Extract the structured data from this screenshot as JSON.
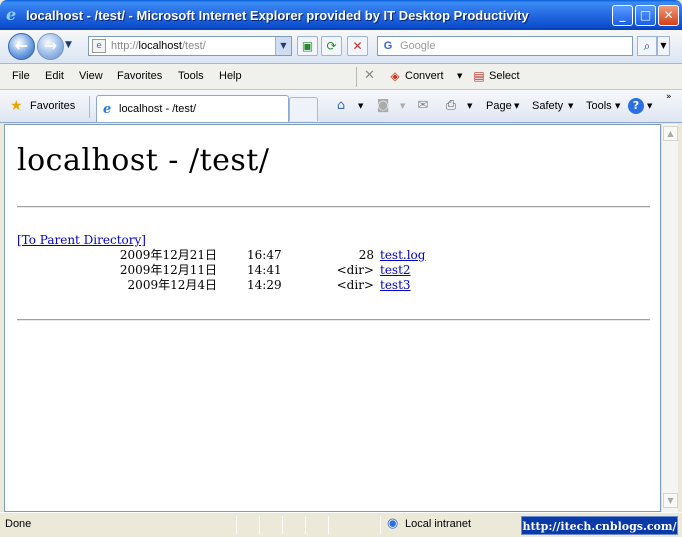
{
  "window": {
    "title": "localhost - /test/ - Microsoft Internet Explorer provided by IT Desktop Productivity",
    "controls": {
      "minimize": "_",
      "maximize": "□",
      "close": "✕"
    }
  },
  "address": {
    "url_prefix": "http://",
    "url_host": "localhost",
    "url_path": "/test/",
    "search_placeholder": "Google"
  },
  "menu": {
    "items": [
      "File",
      "Edit",
      "View",
      "Favorites",
      "Tools",
      "Help"
    ],
    "convert_label": "Convert",
    "select_label": "Select"
  },
  "tabs": {
    "favorites_label": "Favorites",
    "active_tab_label": "localhost - /test/",
    "commands": {
      "page": "Page",
      "safety": "Safety",
      "tools": "Tools"
    }
  },
  "page": {
    "heading": "localhost - /test/",
    "parent_link": "[To Parent Directory]",
    "entries": [
      {
        "date": "2009年12月21日",
        "time": "16:47",
        "size": "28",
        "name": "test.log"
      },
      {
        "date": "2009年12月11日",
        "time": "14:41",
        "size": "<dir>",
        "name": "test2"
      },
      {
        "date": "2009年12月4日",
        "time": "14:29",
        "size": "<dir>",
        "name": "test3"
      }
    ]
  },
  "status": {
    "text": "Done",
    "zone": "Local intranet",
    "watermark": "http://itech.cnblogs.com/"
  },
  "colors": {
    "titlebar": "#0c4fcf",
    "link": "#0000cc",
    "window_frame": "#ece9d8"
  }
}
